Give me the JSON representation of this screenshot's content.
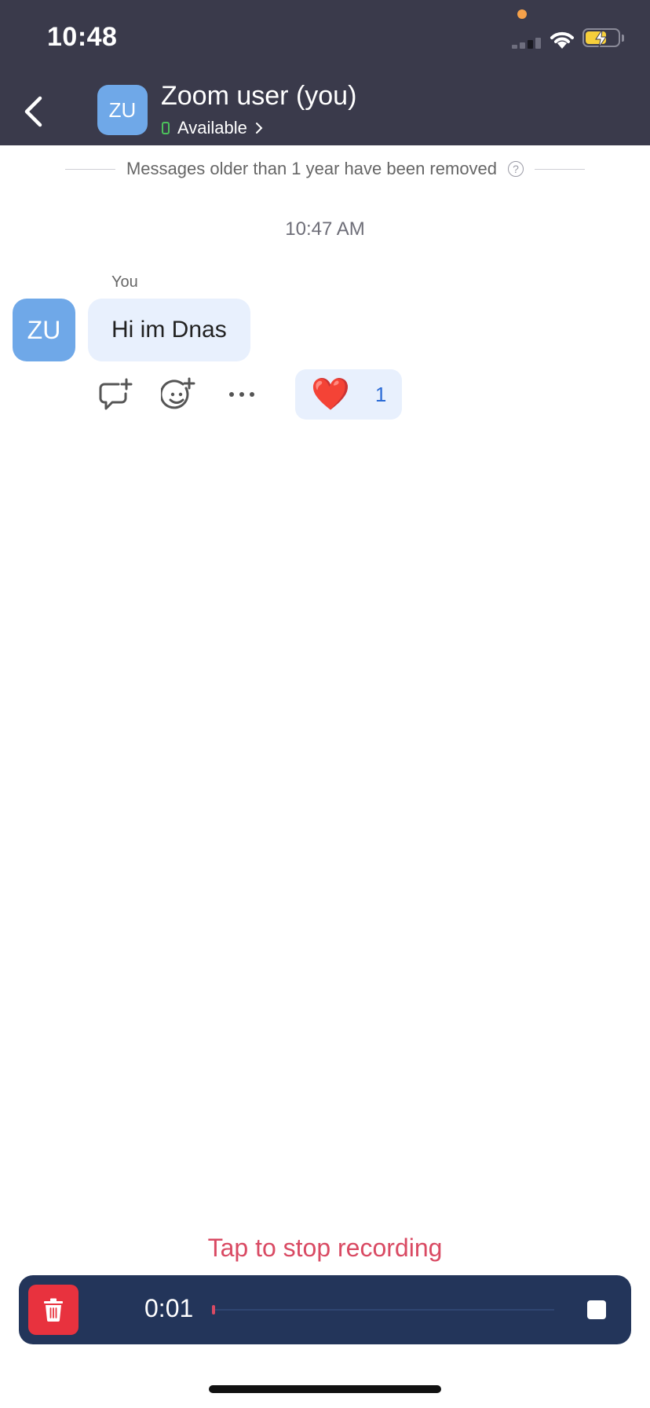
{
  "status_bar": {
    "time": "10:48"
  },
  "header": {
    "avatar_initials": "ZU",
    "title": "Zoom user (you)",
    "presence": "Available"
  },
  "chat": {
    "notice": "Messages older than 1 year have been removed",
    "timestamp": "10:47 AM",
    "messages": [
      {
        "sender": "You",
        "avatar_initials": "ZU",
        "text": "Hi im Dnas",
        "reaction": {
          "emoji": "❤️",
          "count": "1"
        }
      }
    ]
  },
  "recording": {
    "hint": "Tap to stop recording",
    "elapsed": "0:01"
  },
  "icons": {
    "back": "back-arrow-icon",
    "reply": "reply-thread-icon",
    "add_reaction": "add-emoji-icon",
    "more": "more-options-icon",
    "delete": "trash-icon",
    "stop": "stop-icon"
  },
  "colors": {
    "header_bg": "#3a3a4b",
    "avatar": "#6fa8e8",
    "bubble": "#e8f0fd",
    "recording_bar": "#23355a",
    "recording_accent": "#d94a63",
    "delete_button": "#e8323e",
    "presence_green": "#4cc15b"
  }
}
